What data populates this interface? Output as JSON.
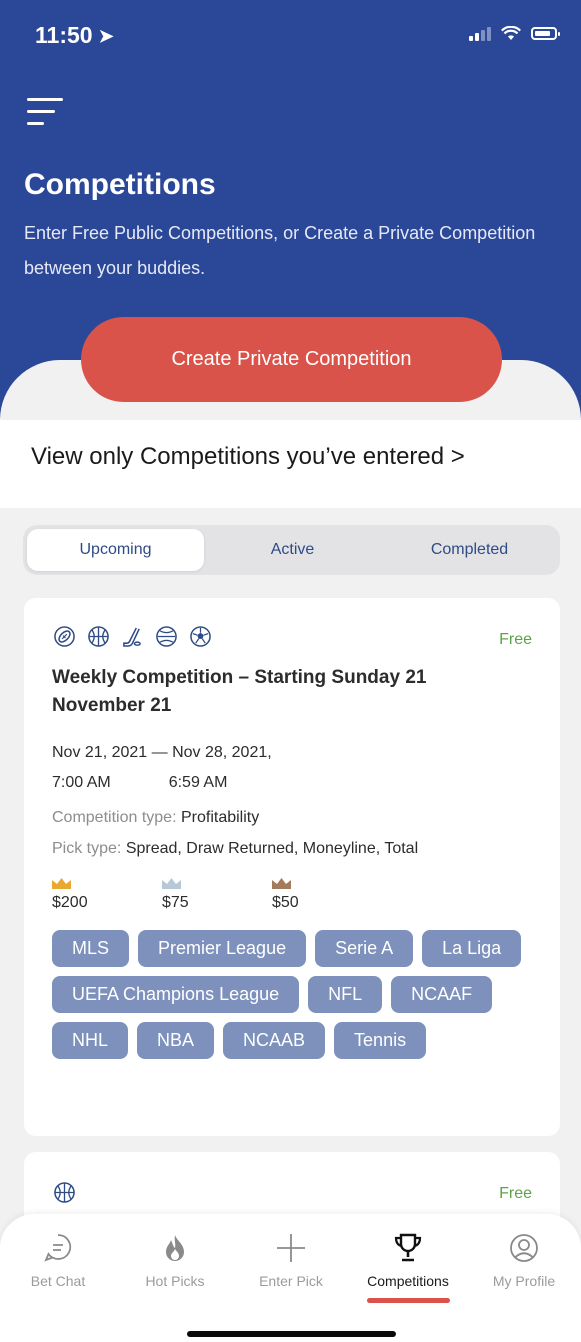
{
  "status_bar": {
    "time": "11:50"
  },
  "header": {
    "title": "Competitions",
    "subtitle": "Enter Free Public Competitions, or Create a Private Competition between your buddies.",
    "create_button": "Create Private Competition"
  },
  "filter_link": "View only Competitions you’ve entered  >",
  "tabs": [
    {
      "label": "Upcoming",
      "active": true
    },
    {
      "label": "Active",
      "active": false
    },
    {
      "label": "Completed",
      "active": false
    }
  ],
  "competitions": [
    {
      "price": "Free",
      "sport_icons": [
        "football-icon",
        "basketball-icon",
        "hockey-icon",
        "soccer-ball-icon",
        "soccer-icon"
      ],
      "title": "Weekly Competition – Starting Sunday 21 November 21",
      "start_date": "Nov 21, 2021 — Nov 28, 2021,",
      "start_time": "7:00 AM",
      "end_time": "6:59 AM",
      "competition_type_label": "Competition type:",
      "competition_type": "Profitability",
      "pick_type_label": "Pick type:",
      "pick_type": "Spread, Draw Returned, Moneyline, Total",
      "prizes": [
        {
          "amount": "$200",
          "crown_color": "#e8a932"
        },
        {
          "amount": "$75",
          "crown_color": "#b9c8d6"
        },
        {
          "amount": "$50",
          "crown_color": "#a47b5c"
        }
      ],
      "leagues": [
        "MLS",
        "Premier League",
        "Serie A",
        "La Liga",
        "UEFA Champions League",
        "NFL",
        "NCAAF",
        "NHL",
        "NBA",
        "NCAAB",
        "Tennis"
      ]
    },
    {
      "price": "Free",
      "sport_icons": [
        "basketball-icon"
      ]
    }
  ],
  "bottom_nav": [
    {
      "label": "Bet Chat",
      "icon": "chat-icon",
      "active": false
    },
    {
      "label": "Hot Picks",
      "icon": "flame-icon",
      "active": false
    },
    {
      "label": "Enter Pick",
      "icon": "plus-icon",
      "active": false
    },
    {
      "label": "Competitions",
      "icon": "trophy-icon",
      "active": true
    },
    {
      "label": "My Profile",
      "icon": "profile-icon",
      "active": false
    }
  ],
  "colors": {
    "header_bg": "#2b4898",
    "accent_red": "#d9534a",
    "chip_bg": "#7d91bc",
    "free_green": "#5fa348"
  }
}
